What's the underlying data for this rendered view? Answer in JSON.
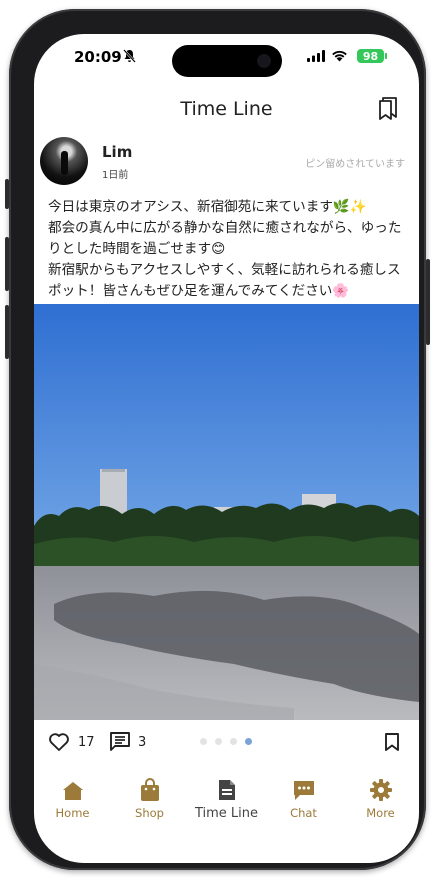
{
  "status_bar": {
    "time": "20:09",
    "battery": "98"
  },
  "header": {
    "title": "Time Line"
  },
  "post": {
    "username": "Lim",
    "time_ago": "1日前",
    "pinned_label": "ピン留めされています",
    "text": "今日は東京のオアシス、新宿御苑に来ています🌿✨\n都会の真ん中に広がる静かな自然に癒されながら、ゆったりとした時間を過ごせます😊\n新宿駅からもアクセスしやすく、気軽に訪れられる癒しスポット！皆さんもぜひ足を運んでみてください🌸",
    "like_count": "17",
    "comment_count": "3",
    "carousel": {
      "pages": 4,
      "current_page": 4
    }
  },
  "tabs": [
    {
      "label": "Home",
      "icon": "home-icon"
    },
    {
      "label": "Shop",
      "icon": "shopping-bag-icon"
    },
    {
      "label": "Time Line",
      "icon": "document-icon"
    },
    {
      "label": "Chat",
      "icon": "chat-icon"
    },
    {
      "label": "More",
      "icon": "gear-icon"
    }
  ],
  "colors": {
    "accent": "#9b7a3a",
    "active_tab": "#444444",
    "dot_active": "#7aa3d6",
    "battery": "#34c759"
  }
}
